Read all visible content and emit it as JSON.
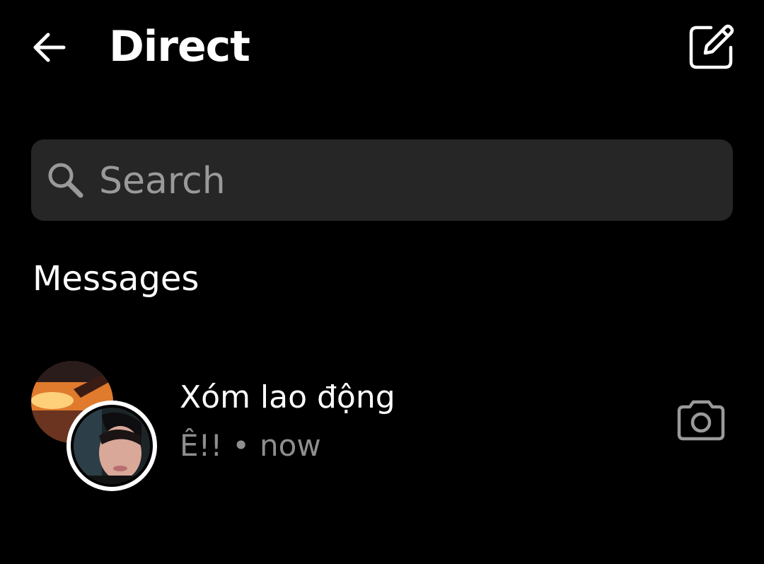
{
  "header": {
    "title": "Direct",
    "back_icon": "arrow-left-icon",
    "compose_icon": "compose-edit-icon"
  },
  "search": {
    "placeholder": "Search",
    "value": "",
    "icon": "search-icon"
  },
  "messages_section": {
    "heading": "Messages"
  },
  "threads": [
    {
      "name": "Xóm lao động",
      "preview_text": "Ê!!",
      "separator": "•",
      "time": "now",
      "avatar_icon": "group-avatar",
      "action_icon": "camera-icon"
    }
  ],
  "colors": {
    "background": "#000000",
    "text_primary": "#ffffff",
    "text_secondary": "#8e8e8e",
    "search_bg": "#262626",
    "search_placeholder": "#9a9a9a"
  }
}
